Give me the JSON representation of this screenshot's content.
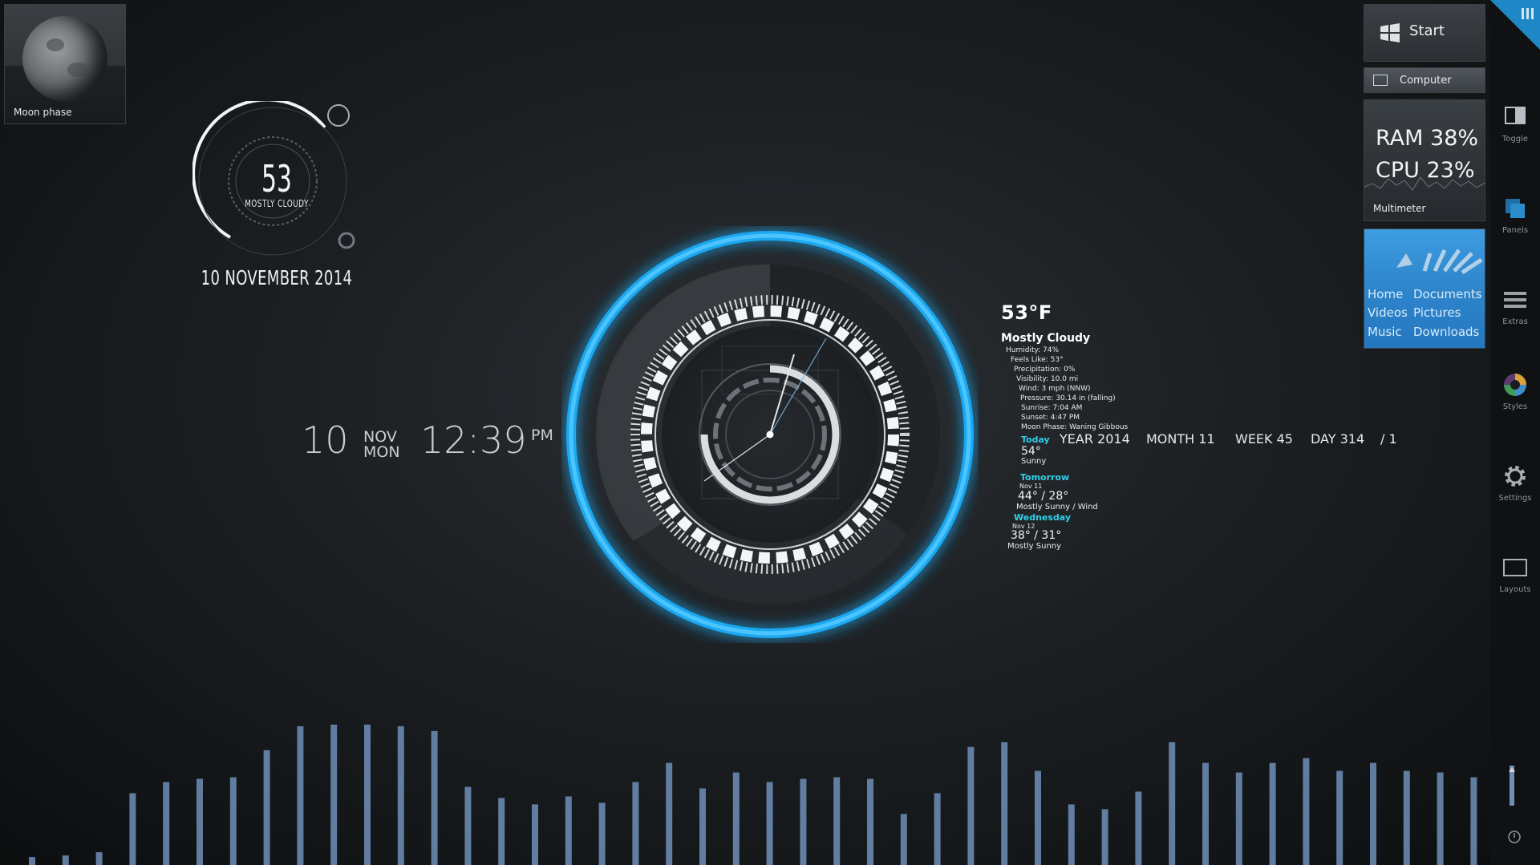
{
  "moon_widget": {
    "label": "Moon phase"
  },
  "ring_weather": {
    "temp": "53",
    "condition": "MOSTLY CLOUDY",
    "date": "10 NOVEMBER 2014"
  },
  "datetime": {
    "day": "10",
    "month": "NOV",
    "weekday": "MON",
    "time": "12:39",
    "ampm": "PM"
  },
  "weather": {
    "temp": "53°F",
    "condition": "Mostly Cloudy",
    "details": [
      "Humidity: 74%",
      "Feels Like: 53°",
      "Precipitation: 0%",
      "Visibility: 10.0 mi",
      "Wind: 3 mph (NNW)",
      "Pressure: 30.14 in (falling)",
      "Sunrise: 7:04 AM",
      "Sunset:  4:47 PM",
      "Moon Phase: Waning Gibbous"
    ],
    "forecast": [
      {
        "day": "Today",
        "date": "",
        "temp": "54°",
        "cond": "Sunny"
      },
      {
        "day": "Tomorrow",
        "date": "Nov 11",
        "temp": "44° / 28°",
        "cond": "Mostly Sunny / Wind"
      },
      {
        "day": "Wednesday",
        "date": "Nov 12",
        "temp": "38° / 31°",
        "cond": "Mostly Sunny"
      }
    ]
  },
  "counters": {
    "year": "YEAR 2014",
    "month": "MONTH 11",
    "week": "WEEK 45",
    "day": "DAY 314",
    "slash": "/ 1"
  },
  "panel": {
    "start": "Start",
    "computer": "Computer",
    "multimeter": {
      "ram": "RAM 38%",
      "cpu": "CPU 23%",
      "label": "Multimeter"
    },
    "places": [
      "Home",
      "Documents",
      "Videos",
      "Pictures",
      "Music",
      "Downloads"
    ]
  },
  "sidebar": {
    "items": [
      {
        "label": "Toggle",
        "icon": "toggle-icon"
      },
      {
        "label": "Panels",
        "icon": "panels-icon"
      },
      {
        "label": "Extras",
        "icon": "extras-icon"
      },
      {
        "label": "Styles",
        "icon": "styles-icon"
      },
      {
        "label": "Settings",
        "icon": "gear-icon"
      },
      {
        "label": "Layouts",
        "icon": "layouts-icon"
      }
    ]
  },
  "colors": {
    "accent": "#1ea8f0",
    "forecast_day": "#2fd1ea",
    "bars": "#6f8fb8"
  },
  "visualizer": {
    "levels": [
      0.05,
      0.06,
      0.08,
      0.45,
      0.52,
      0.54,
      0.55,
      0.72,
      0.87,
      0.88,
      0.88,
      0.87,
      0.84,
      0.49,
      0.42,
      0.38,
      0.43,
      0.39,
      0.52,
      0.64,
      0.48,
      0.58,
      0.52,
      0.54,
      0.55,
      0.54,
      0.32,
      0.45,
      0.74,
      0.77,
      0.59,
      0.38,
      0.35,
      0.46,
      0.77,
      0.64,
      0.58,
      0.64,
      0.67,
      0.59,
      0.64,
      0.59,
      0.58,
      0.55
    ]
  }
}
